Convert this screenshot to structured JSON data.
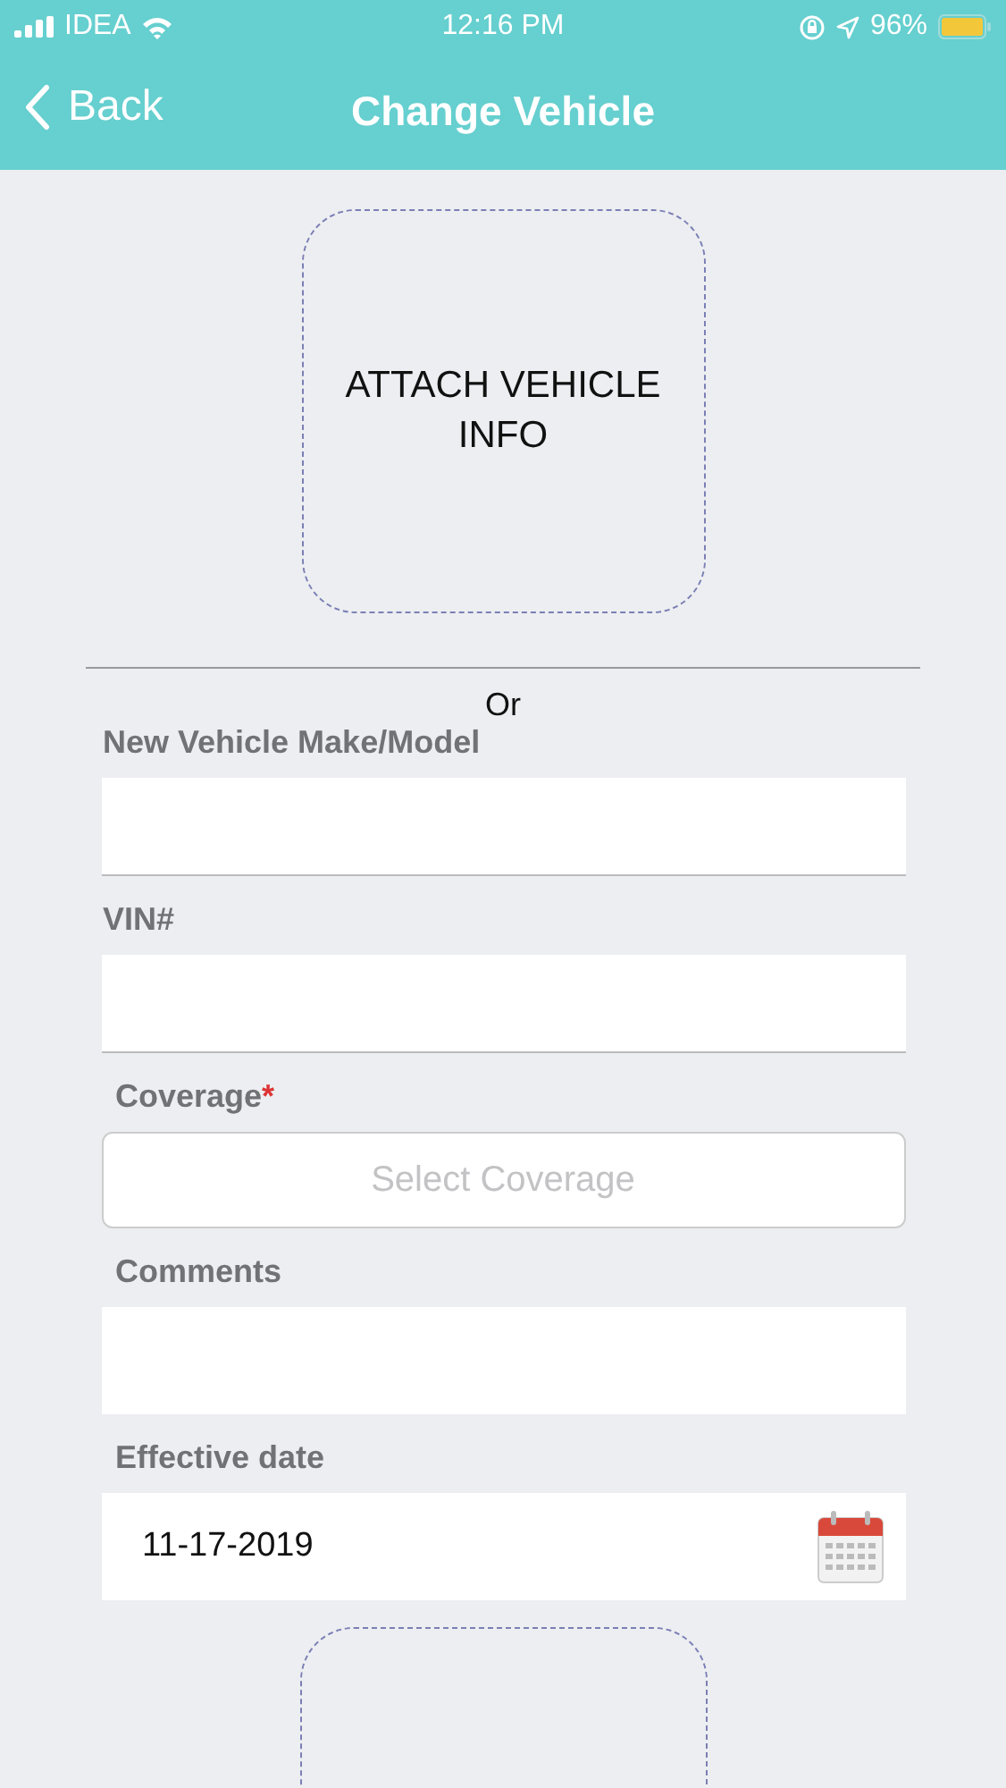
{
  "status_bar": {
    "carrier": "IDEA",
    "time": "12:16 PM",
    "battery": "96%"
  },
  "nav": {
    "back": "Back",
    "title": "Change Vehicle"
  },
  "attach": {
    "label": "ATTACH VEHICLE INFO"
  },
  "divider_text": "Or",
  "fields": [
    {
      "kind": "text",
      "label": "New Vehicle Make/Model"
    },
    {
      "kind": "text",
      "label": "VIN#"
    },
    {
      "kind": "select",
      "label": "Coverage",
      "required_mark": "*",
      "placeholder": "Select Coverage"
    },
    {
      "kind": "tall",
      "label": "Comments"
    },
    {
      "kind": "date",
      "label": "Effective date",
      "value": "11-17-2019"
    }
  ]
}
